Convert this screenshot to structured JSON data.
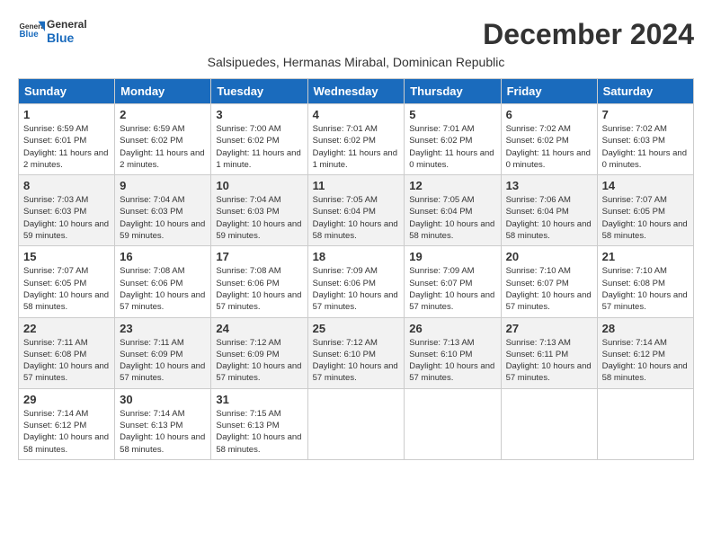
{
  "header": {
    "logo_general": "General",
    "logo_blue": "Blue",
    "month_title": "December 2024",
    "subtitle": "Salsipuedes, Hermanas Mirabal, Dominican Republic"
  },
  "weekdays": [
    "Sunday",
    "Monday",
    "Tuesday",
    "Wednesday",
    "Thursday",
    "Friday",
    "Saturday"
  ],
  "weeks": [
    [
      {
        "day": "1",
        "info": "Sunrise: 6:59 AM\nSunset: 6:01 PM\nDaylight: 11 hours and 2 minutes."
      },
      {
        "day": "2",
        "info": "Sunrise: 6:59 AM\nSunset: 6:02 PM\nDaylight: 11 hours and 2 minutes."
      },
      {
        "day": "3",
        "info": "Sunrise: 7:00 AM\nSunset: 6:02 PM\nDaylight: 11 hours and 1 minute."
      },
      {
        "day": "4",
        "info": "Sunrise: 7:01 AM\nSunset: 6:02 PM\nDaylight: 11 hours and 1 minute."
      },
      {
        "day": "5",
        "info": "Sunrise: 7:01 AM\nSunset: 6:02 PM\nDaylight: 11 hours and 0 minutes."
      },
      {
        "day": "6",
        "info": "Sunrise: 7:02 AM\nSunset: 6:02 PM\nDaylight: 11 hours and 0 minutes."
      },
      {
        "day": "7",
        "info": "Sunrise: 7:02 AM\nSunset: 6:03 PM\nDaylight: 11 hours and 0 minutes."
      }
    ],
    [
      {
        "day": "8",
        "info": "Sunrise: 7:03 AM\nSunset: 6:03 PM\nDaylight: 10 hours and 59 minutes."
      },
      {
        "day": "9",
        "info": "Sunrise: 7:04 AM\nSunset: 6:03 PM\nDaylight: 10 hours and 59 minutes."
      },
      {
        "day": "10",
        "info": "Sunrise: 7:04 AM\nSunset: 6:03 PM\nDaylight: 10 hours and 59 minutes."
      },
      {
        "day": "11",
        "info": "Sunrise: 7:05 AM\nSunset: 6:04 PM\nDaylight: 10 hours and 58 minutes."
      },
      {
        "day": "12",
        "info": "Sunrise: 7:05 AM\nSunset: 6:04 PM\nDaylight: 10 hours and 58 minutes."
      },
      {
        "day": "13",
        "info": "Sunrise: 7:06 AM\nSunset: 6:04 PM\nDaylight: 10 hours and 58 minutes."
      },
      {
        "day": "14",
        "info": "Sunrise: 7:07 AM\nSunset: 6:05 PM\nDaylight: 10 hours and 58 minutes."
      }
    ],
    [
      {
        "day": "15",
        "info": "Sunrise: 7:07 AM\nSunset: 6:05 PM\nDaylight: 10 hours and 58 minutes."
      },
      {
        "day": "16",
        "info": "Sunrise: 7:08 AM\nSunset: 6:06 PM\nDaylight: 10 hours and 57 minutes."
      },
      {
        "day": "17",
        "info": "Sunrise: 7:08 AM\nSunset: 6:06 PM\nDaylight: 10 hours and 57 minutes."
      },
      {
        "day": "18",
        "info": "Sunrise: 7:09 AM\nSunset: 6:06 PM\nDaylight: 10 hours and 57 minutes."
      },
      {
        "day": "19",
        "info": "Sunrise: 7:09 AM\nSunset: 6:07 PM\nDaylight: 10 hours and 57 minutes."
      },
      {
        "day": "20",
        "info": "Sunrise: 7:10 AM\nSunset: 6:07 PM\nDaylight: 10 hours and 57 minutes."
      },
      {
        "day": "21",
        "info": "Sunrise: 7:10 AM\nSunset: 6:08 PM\nDaylight: 10 hours and 57 minutes."
      }
    ],
    [
      {
        "day": "22",
        "info": "Sunrise: 7:11 AM\nSunset: 6:08 PM\nDaylight: 10 hours and 57 minutes."
      },
      {
        "day": "23",
        "info": "Sunrise: 7:11 AM\nSunset: 6:09 PM\nDaylight: 10 hours and 57 minutes."
      },
      {
        "day": "24",
        "info": "Sunrise: 7:12 AM\nSunset: 6:09 PM\nDaylight: 10 hours and 57 minutes."
      },
      {
        "day": "25",
        "info": "Sunrise: 7:12 AM\nSunset: 6:10 PM\nDaylight: 10 hours and 57 minutes."
      },
      {
        "day": "26",
        "info": "Sunrise: 7:13 AM\nSunset: 6:10 PM\nDaylight: 10 hours and 57 minutes."
      },
      {
        "day": "27",
        "info": "Sunrise: 7:13 AM\nSunset: 6:11 PM\nDaylight: 10 hours and 57 minutes."
      },
      {
        "day": "28",
        "info": "Sunrise: 7:14 AM\nSunset: 6:12 PM\nDaylight: 10 hours and 58 minutes."
      }
    ],
    [
      {
        "day": "29",
        "info": "Sunrise: 7:14 AM\nSunset: 6:12 PM\nDaylight: 10 hours and 58 minutes."
      },
      {
        "day": "30",
        "info": "Sunrise: 7:14 AM\nSunset: 6:13 PM\nDaylight: 10 hours and 58 minutes."
      },
      {
        "day": "31",
        "info": "Sunrise: 7:15 AM\nSunset: 6:13 PM\nDaylight: 10 hours and 58 minutes."
      },
      null,
      null,
      null,
      null
    ]
  ]
}
